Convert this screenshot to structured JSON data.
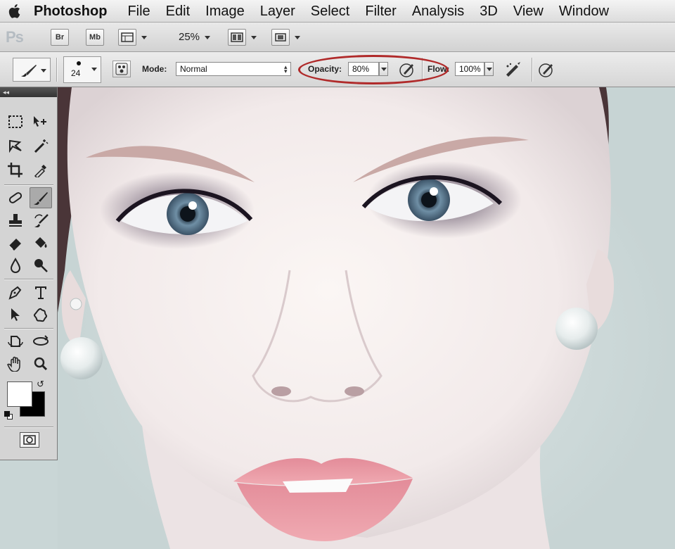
{
  "menubar": {
    "apple_icon": "apple-logo-icon",
    "items": [
      "Photoshop",
      "File",
      "Edit",
      "Image",
      "Layer",
      "Select",
      "Filter",
      "Analysis",
      "3D",
      "View",
      "Window"
    ]
  },
  "appbar": {
    "logo": "Ps",
    "bridge_label": "Br",
    "minibridge_label": "Mb",
    "zoom": "25%"
  },
  "options": {
    "brush_size": "24",
    "mode_label": "Mode:",
    "mode_value": "Normal",
    "opacity_label": "Opacity:",
    "opacity_value": "80%",
    "flow_label": "Flow:",
    "flow_value": "100%",
    "highlight_color": "#b02a2a"
  },
  "colors": {
    "foreground": "#ffffff",
    "background": "#000000"
  }
}
